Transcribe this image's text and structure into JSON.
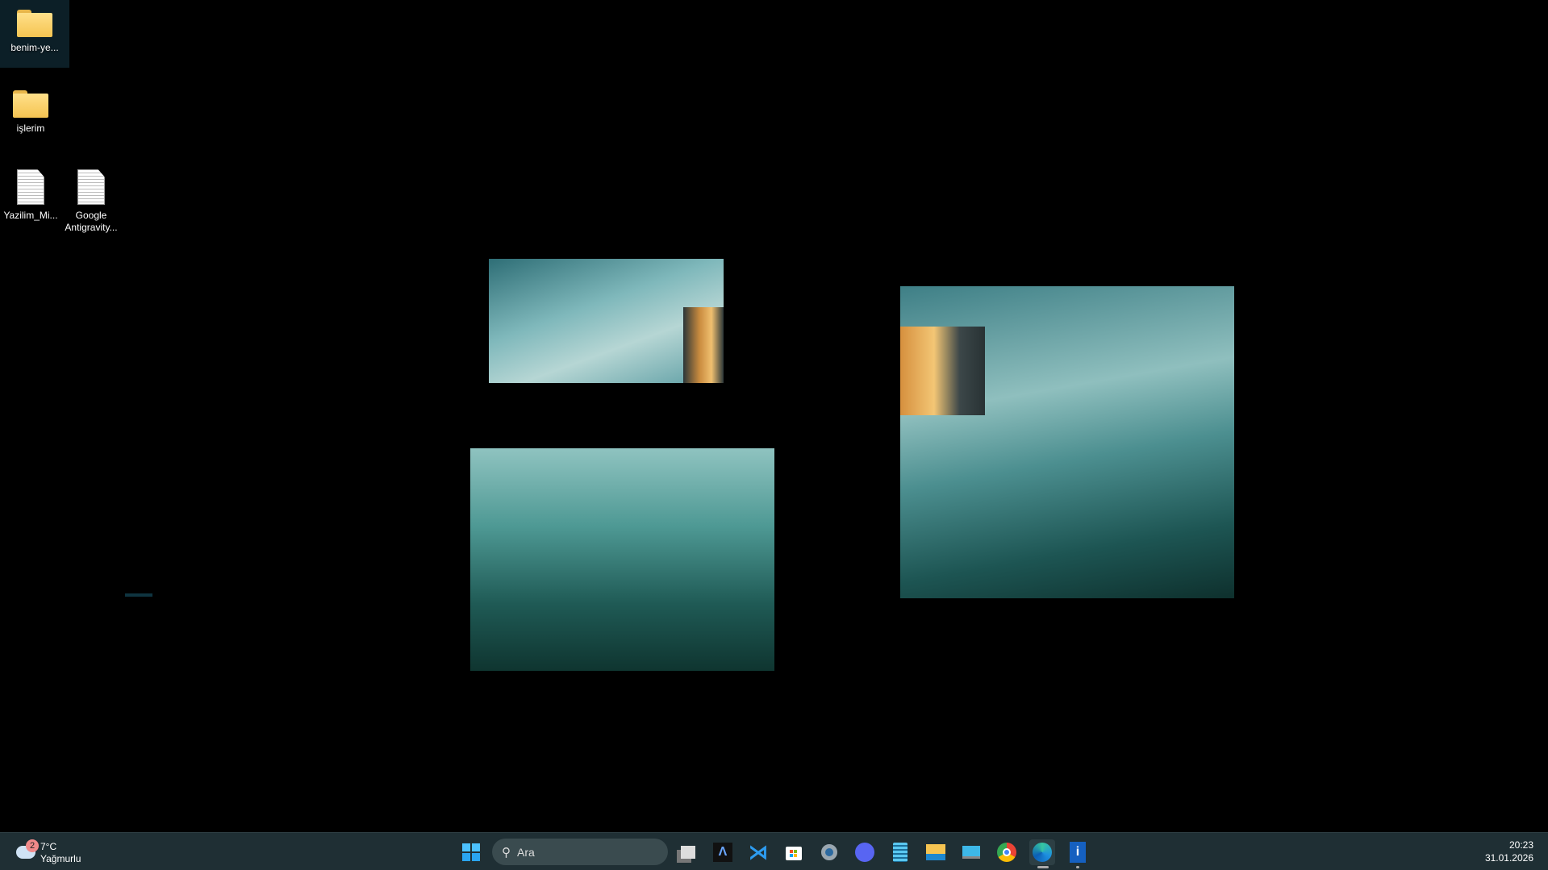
{
  "desktop": {
    "icons": [
      {
        "label": "benim-ye...",
        "type": "folder",
        "selected": true
      },
      {
        "label": "işlerim",
        "type": "folder"
      },
      {
        "label": "Yazilim_Mi...",
        "type": "document"
      },
      {
        "label": "Google Antigravity...",
        "type": "document"
      }
    ]
  },
  "taskbar": {
    "weather": {
      "temp": "7°C",
      "condition": "Yağmurlu",
      "badge": "2"
    },
    "search_placeholder": "Ara",
    "apps": [
      "task-view",
      "antigravity",
      "vscode",
      "microsoft-store",
      "settings",
      "discord",
      "notepad",
      "file-explorer",
      "remote-desktop",
      "chrome",
      "edge",
      "info-app"
    ],
    "clock": {
      "time": "20:23",
      "date": "31.01.2026"
    }
  }
}
